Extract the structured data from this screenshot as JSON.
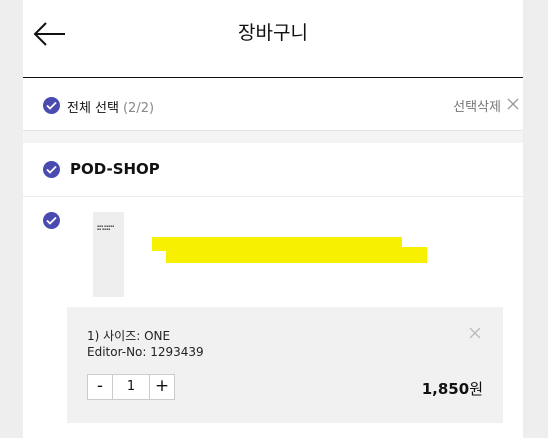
{
  "header": {
    "title": "장바구니"
  },
  "select_all": {
    "label": "전체 선택",
    "count": "(2/2)",
    "delete_label": "선택삭제"
  },
  "shop": {
    "name": "POD-SHOP"
  },
  "item": {
    "option_size": "1) 사이즈: ONE",
    "editor_no": "Editor-No: 1293439",
    "quantity": "1",
    "minus_label": "-",
    "plus_label": "+",
    "price": "1,850",
    "currency": "원"
  },
  "colors": {
    "accent": "#4a4bb0",
    "highlight": "#f7f000"
  },
  "icons": [
    "back-arrow-icon",
    "check-icon",
    "close-icon"
  ]
}
